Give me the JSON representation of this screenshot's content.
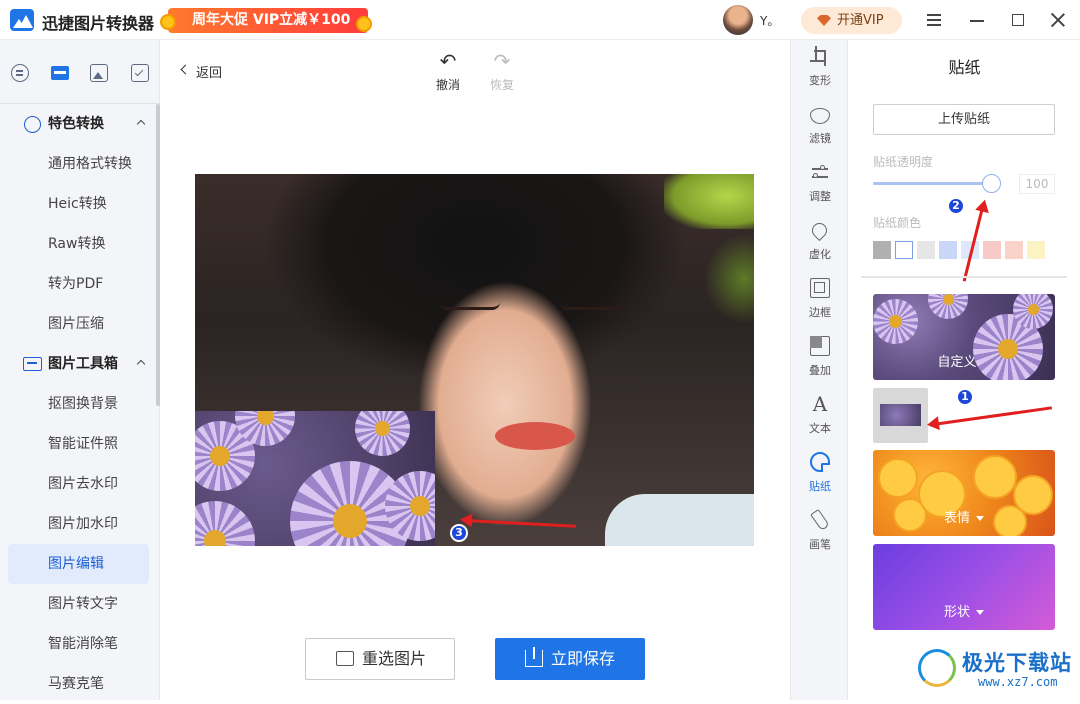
{
  "titlebar": {
    "app_name": "迅捷图片转换器",
    "promo": "周年大促 VIP立减￥100",
    "username": "Y。",
    "vip_button": "开通VIP"
  },
  "sidebar": {
    "groups": [
      {
        "label": "特色转换",
        "items": [
          "通用格式转换",
          "Heic转换",
          "Raw转换",
          "转为PDF",
          "图片压缩"
        ]
      },
      {
        "label": "图片工具箱",
        "items": [
          "抠图换背景",
          "智能证件照",
          "图片去水印",
          "图片加水印",
          "图片编辑",
          "图片转文字",
          "智能消除笔",
          "马赛克笔"
        ]
      }
    ],
    "active_item": "图片编辑"
  },
  "main": {
    "back_label": "返回",
    "undo_label": "撤消",
    "redo_label": "恢复",
    "reselect_label": "重选图片",
    "save_label": "立即保存",
    "annotations": [
      "1",
      "2",
      "3"
    ]
  },
  "tools": [
    "变形",
    "滤镜",
    "调整",
    "虚化",
    "边框",
    "叠加",
    "文本",
    "贴纸",
    "画笔"
  ],
  "active_tool": "贴纸",
  "panel": {
    "title": "贴纸",
    "upload_label": "上传贴纸",
    "opacity_label": "贴纸透明度",
    "opacity_value": "100",
    "opacity_level": 1.0,
    "color_label": "贴纸颜色",
    "colors": [
      "#b0b0b0",
      "#ffffff",
      "#e6e6e6",
      "#c9d6f7",
      "#dfe8fb",
      "#f7c9c9",
      "#f9d3c7",
      "#fbf3c4"
    ],
    "categories": [
      "自定义",
      "表情",
      "形状"
    ]
  },
  "watermark": {
    "text": "极光下载站",
    "url": "www.xz7.com"
  }
}
